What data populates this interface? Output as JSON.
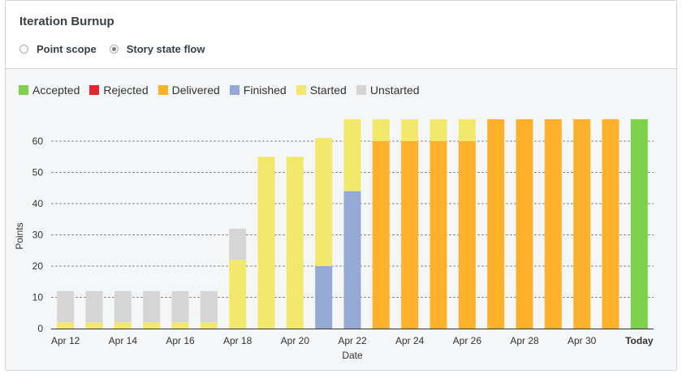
{
  "widget": {
    "title": "Iteration Burnup",
    "modes": [
      {
        "label": "Point scope",
        "selected": false
      },
      {
        "label": "Story state flow",
        "selected": true
      }
    ]
  },
  "legend": [
    {
      "label": "Accepted",
      "color": "#7ed24b"
    },
    {
      "label": "Rejected",
      "color": "#e4262c"
    },
    {
      "label": "Delivered",
      "color": "#ffb12b"
    },
    {
      "label": "Finished",
      "color": "#94a9d4"
    },
    {
      "label": "Started",
      "color": "#f2e86b"
    },
    {
      "label": "Unstarted",
      "color": "#d5d5d5"
    }
  ],
  "chart_data": {
    "type": "bar",
    "stacked": true,
    "xlabel": "Date",
    "ylabel": "Points",
    "ylim": [
      0,
      67
    ],
    "yticks": [
      0,
      10,
      20,
      30,
      40,
      50,
      60
    ],
    "grid": true,
    "categories": [
      "Apr 12",
      "Apr 13",
      "Apr 14",
      "Apr 15",
      "Apr 16",
      "Apr 17",
      "Apr 18",
      "Apr 19",
      "Apr 20",
      "Apr 21",
      "Apr 22",
      "Apr 23",
      "Apr 24",
      "Apr 25",
      "Apr 26",
      "Apr 27",
      "Apr 28",
      "Apr 29",
      "Apr 30",
      "May 1",
      "Today"
    ],
    "tick_labels": [
      "Apr 12",
      "",
      "Apr 14",
      "",
      "Apr 16",
      "",
      "Apr 18",
      "",
      "Apr 20",
      "",
      "Apr 22",
      "",
      "Apr 24",
      "",
      "Apr 26",
      "",
      "Apr 28",
      "",
      "Apr 30",
      "",
      "Today"
    ],
    "series": [
      {
        "name": "Accepted",
        "values": [
          0,
          0,
          0,
          0,
          0,
          0,
          0,
          0,
          0,
          0,
          0,
          0,
          0,
          0,
          0,
          0,
          0,
          0,
          0,
          0,
          67
        ]
      },
      {
        "name": "Rejected",
        "values": [
          0,
          0,
          0,
          0,
          0,
          0,
          0,
          0,
          0,
          0,
          0,
          0,
          0,
          0,
          0,
          0,
          0,
          0,
          0,
          0,
          0
        ]
      },
      {
        "name": "Delivered",
        "values": [
          0,
          0,
          0,
          0,
          0,
          0,
          0,
          0,
          0,
          0,
          0,
          60,
          60,
          60,
          60,
          67,
          67,
          67,
          67,
          67,
          0
        ]
      },
      {
        "name": "Finished",
        "values": [
          0,
          0,
          0,
          0,
          0,
          0,
          0,
          0,
          0,
          20,
          44,
          0,
          0,
          0,
          0,
          0,
          0,
          0,
          0,
          0,
          0
        ]
      },
      {
        "name": "Started",
        "values": [
          2,
          2,
          2,
          2,
          2,
          2,
          22,
          55,
          55,
          41,
          23,
          7,
          7,
          7,
          7,
          0,
          0,
          0,
          0,
          0,
          0
        ]
      },
      {
        "name": "Unstarted",
        "values": [
          10,
          10,
          10,
          10,
          10,
          10,
          10,
          0,
          0,
          0,
          0,
          0,
          0,
          0,
          0,
          0,
          0,
          0,
          0,
          0,
          0
        ]
      }
    ]
  }
}
